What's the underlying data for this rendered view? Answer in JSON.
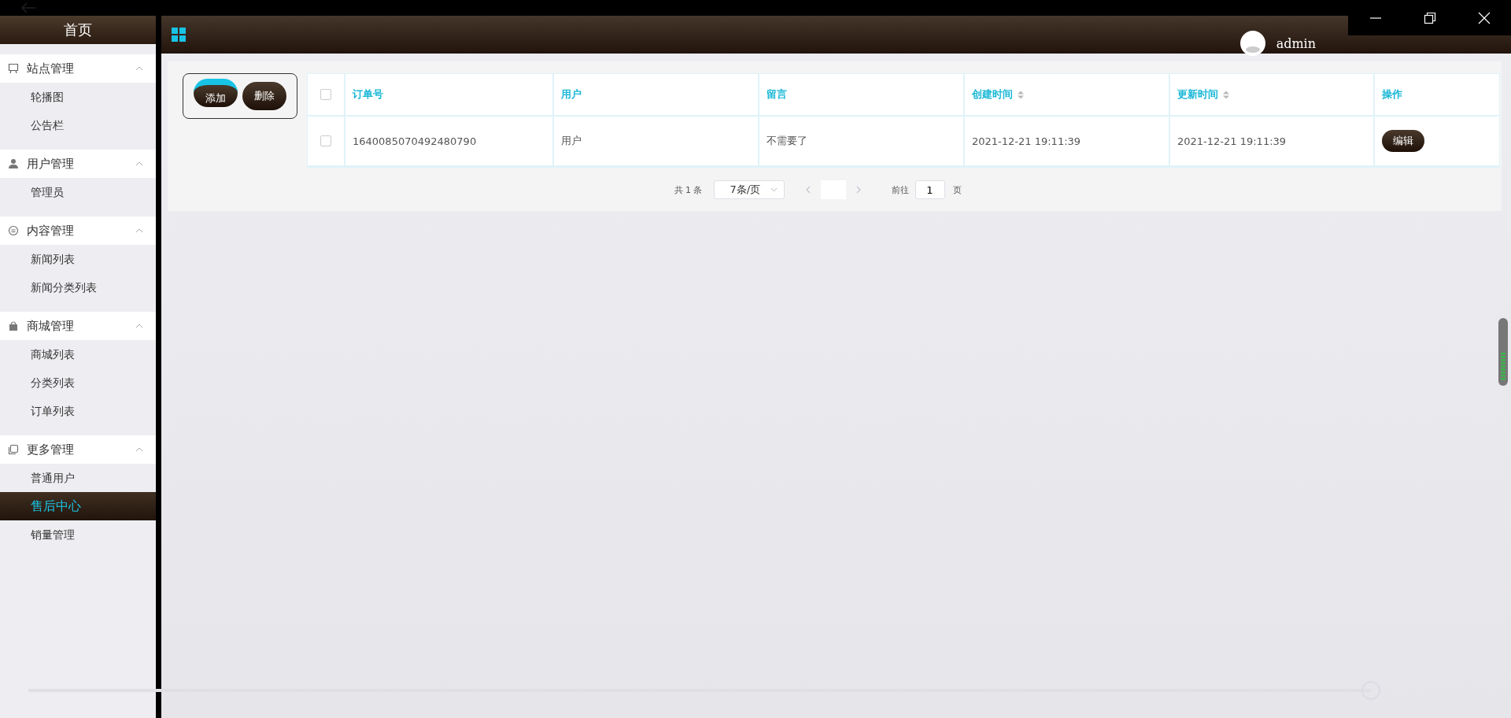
{
  "sidebar": {
    "title": "首页",
    "groups": [
      {
        "label": "站点管理",
        "expanded": true,
        "items": [
          {
            "label": "轮播图",
            "selected": false
          },
          {
            "label": "公告栏",
            "selected": false
          }
        ]
      },
      {
        "label": "用户管理",
        "expanded": true,
        "items": [
          {
            "label": "管理员",
            "selected": false
          }
        ]
      },
      {
        "label": "内容管理",
        "expanded": true,
        "items": [
          {
            "label": "新闻列表",
            "selected": false
          },
          {
            "label": "新闻分类列表",
            "selected": false
          }
        ]
      },
      {
        "label": "商城管理",
        "expanded": true,
        "items": [
          {
            "label": "商城列表",
            "selected": false
          },
          {
            "label": "分类列表",
            "selected": false
          },
          {
            "label": "订单列表",
            "selected": false
          }
        ]
      },
      {
        "label": "更多管理",
        "expanded": true,
        "items": [
          {
            "label": "普通用户",
            "selected": false
          },
          {
            "label": "售后中心",
            "selected": true
          },
          {
            "label": "销量管理",
            "selected": false
          }
        ]
      }
    ]
  },
  "header": {
    "user": "admin"
  },
  "toolbar": {
    "buttons": [
      "添加",
      "删除"
    ]
  },
  "table": {
    "columns": [
      {
        "label": "订单号",
        "sortable": false
      },
      {
        "label": "用户",
        "sortable": false
      },
      {
        "label": "留言",
        "sortable": false
      },
      {
        "label": "创建时间",
        "sortable": true
      },
      {
        "label": "更新时间",
        "sortable": true
      },
      {
        "label": "操作",
        "sortable": false
      }
    ],
    "all_checked": false,
    "rows": [
      {
        "checked": false,
        "cells": [
          "1640085070492480790",
          "用户",
          "不需要了",
          "2021-12-21 19:11:39",
          "2021-12-21 19:11:39"
        ],
        "action": "编辑"
      }
    ]
  },
  "pagination": {
    "total": "共 1 条",
    "page_size": "7条/页",
    "goto_label": "前往",
    "page": "1",
    "page_suffix": "页"
  },
  "player": {
    "level": 1
  }
}
